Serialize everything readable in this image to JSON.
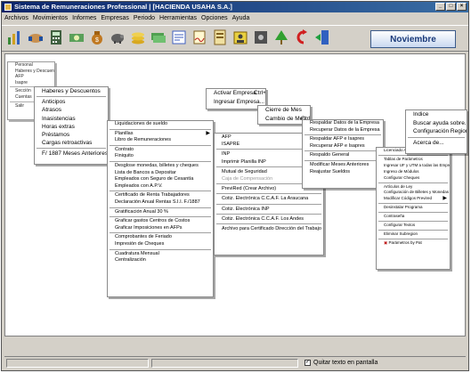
{
  "window": {
    "title": "Sistema de Remuneraciones Professional | [HACIENDA USAHA S.A.]"
  },
  "menubar": [
    "Archivos",
    "Movimientos",
    "Informes",
    "Empresas",
    "Periodo",
    "Herramientas",
    "Opciones",
    "Ayuda"
  ],
  "period": "Noviembre",
  "status": {
    "checkbox_label": "Quitar texto en pantalla",
    "checked": true
  },
  "menu_archivos": [
    "Personal",
    "Haberes y Descuentos",
    "AFP",
    "Isapre",
    "Sección",
    "Cuentas",
    "Salir"
  ],
  "menu_movimientos": [
    "Haberes y Descuentos",
    "Anticipos",
    "Atrasos",
    "Inasistencias",
    "Horas extras",
    "Préstamos",
    "Cargas retroactivas",
    "F/ 1887 Meses Anteriores"
  ],
  "menu_informes": [
    "Liquidaciones de sueldo",
    "Planillas",
    "Libro de Remuneraciones",
    "Contrato",
    "Finiquito",
    "Desglose monedas, billetes y cheques",
    "Lista de Bancos a Depositar",
    "Empleados con Seguro de Cesantía",
    "Empleados con A.P.V.",
    "Certificado de Renta Trabajadores",
    "Declaración Anual Rentas S.I.I. F./1887",
    "Gratificación Anual 30 %",
    "Graficar gastos Centros de Costos",
    "Graficar Imposiciones en AFPs",
    "Comprobantes de Feriado",
    "Impresión de Cheques",
    "Cuadratura Mensual",
    "Centralización"
  ],
  "menu_planillas": [
    "AFP",
    "ISAPRE",
    "INP",
    "Imprimir Planilla INP",
    "Mutual de Seguridad",
    "Caja de Compensación",
    "PreviRed (Crear Archivo)",
    "Cotiz. Electrónica C.C.A.F. La Araucana",
    "Cotiz. Electrónica INP",
    "Cotiz. Electrónica C.C.A.F. Los Andes",
    "Archivo para Certificado Dirección del Trabajo"
  ],
  "menu_empresas": [
    "Activar Empresa",
    "Ctrl+A",
    "Ingresar Empresa..."
  ],
  "menu_periodo": [
    "Cierre de Mes",
    "Cambio de Mes",
    "Ctrl+M"
  ],
  "menu_herramientas": [
    "Respaldar Datos de la Empresa",
    "Recuperar Datos de la Empresa",
    "Respaldar AFP e Isapres",
    "Recuperar AFP e Isapres",
    "Respaldo General",
    "Modificar Meses Anteriores",
    "Reajustar Sueldos"
  ],
  "menu_opciones": [
    "Licenciado A.",
    "Tablas de Parámetros",
    "Ingresar UF y UTM a todas las Empresas",
    "Ingreso de Módulos",
    "Configurar Cheques",
    "Artículos de Ley",
    "Configuración de Billetes y Monedas",
    "Modificar Códigos Previred",
    "Desinstalar Programa",
    "Contraseña",
    "Configurar Textos",
    "Eliminar Subregion",
    "Parámetros by Pat"
  ],
  "menu_ayuda": [
    "Indice",
    "Buscar ayuda sobre...",
    "Configuración Regional",
    "Acerca de..."
  ],
  "toolbar_icons": [
    "chart-icon",
    "handshake-icon",
    "calculator-icon",
    "money-icon",
    "moneybag-icon",
    "piggybank-icon",
    "coins-icon",
    "cash-icon",
    "certificate-icon",
    "signature-icon",
    "document-icon",
    "contacts-icon",
    "safe-icon",
    "tree-icon",
    "exit-arrow-icon",
    "door-exit-icon"
  ]
}
